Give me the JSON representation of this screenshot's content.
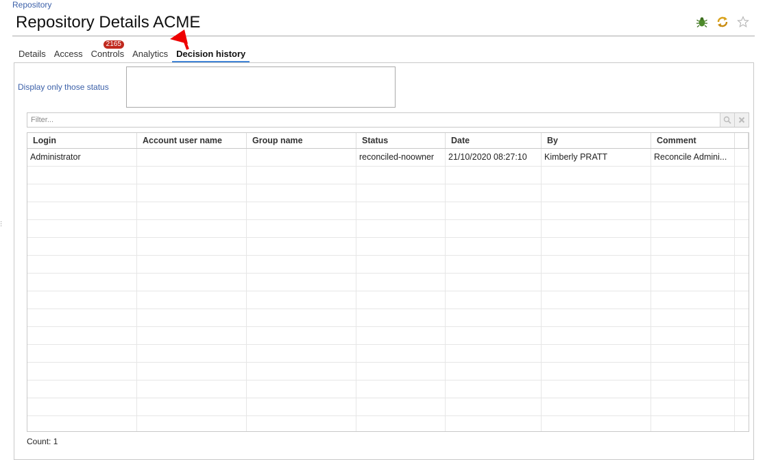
{
  "breadcrumb": "Repository",
  "page_title": "Repository Details ACME",
  "tabs": [
    {
      "label": "Details"
    },
    {
      "label": "Access"
    },
    {
      "label": "Controls",
      "badge": "2165"
    },
    {
      "label": "Analytics"
    },
    {
      "label": "Decision history",
      "active": true
    }
  ],
  "status_filter": {
    "label": "Display only those status"
  },
  "filter": {
    "placeholder": "Filter..."
  },
  "table": {
    "columns": [
      "Login",
      "Account user name",
      "Group name",
      "Status",
      "Date",
      "By",
      "Comment"
    ],
    "rows": [
      [
        "Administrator",
        "",
        "",
        "reconciled-noowner",
        "21/10/2020 08:27:10",
        "Kimberly PRATT",
        "Reconcile Admini..."
      ]
    ]
  },
  "count_text": "Count: 1",
  "colors": {
    "accent": "#3f83d6",
    "badge": "#c0291e",
    "label_blue": "#3a5fa8"
  },
  "icons": [
    "bug-icon",
    "refresh-icon",
    "star-icon",
    "search-icon",
    "clear-icon",
    "arrow-annotation-icon"
  ]
}
